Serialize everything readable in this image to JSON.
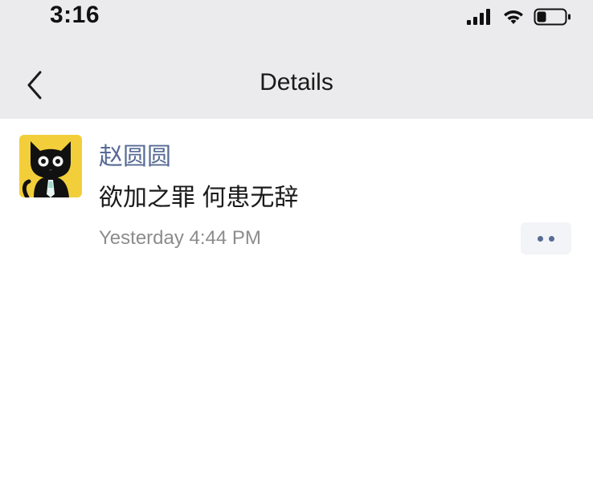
{
  "status_bar": {
    "time": "3:16",
    "icons": [
      "cellular-signal-icon",
      "wifi-icon",
      "battery-icon"
    ]
  },
  "nav": {
    "back_icon": "chevron-left-icon",
    "title": "Details"
  },
  "post": {
    "avatar": "black-cat-avatar",
    "author": "赵圆圆",
    "text": "欲加之罪 何患无辞",
    "timestamp": "Yesterday 4:44 PM",
    "more_icon": "two-dots-icon"
  },
  "colors": {
    "top_background": "#ebebed",
    "author_link": "#576b95",
    "timestamp": "#8c8c8c",
    "avatar_background": "#f2cf3a"
  }
}
